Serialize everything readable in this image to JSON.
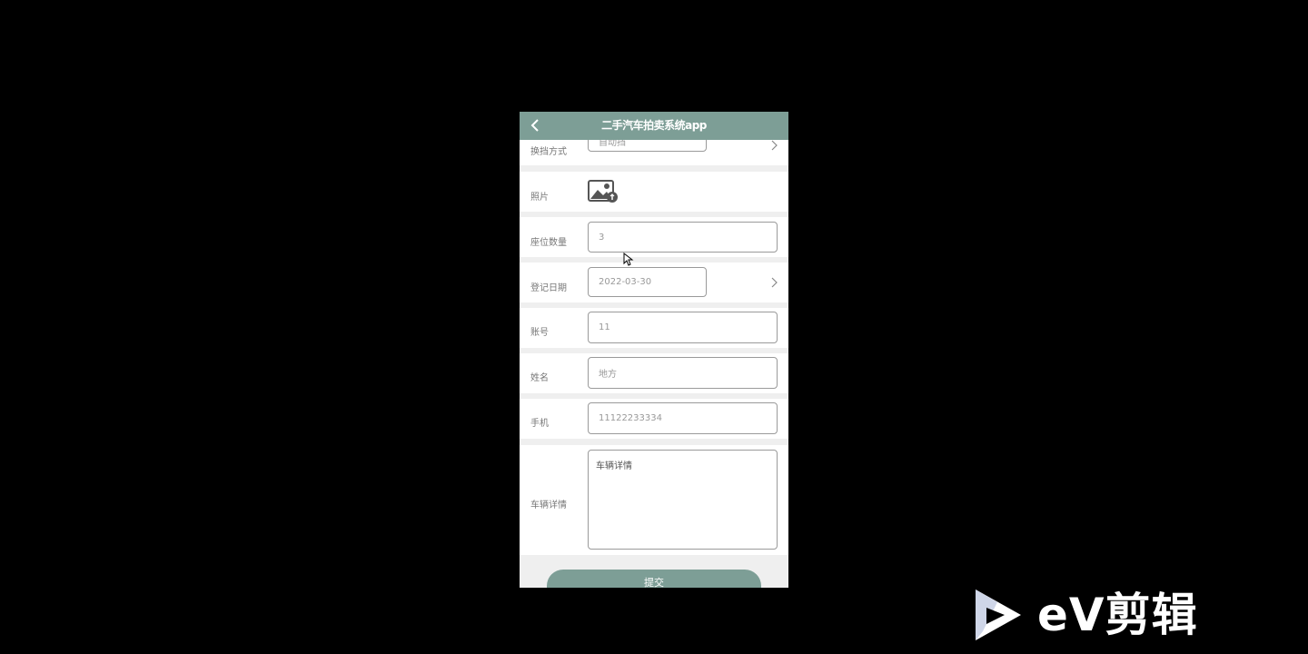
{
  "app": {
    "title": "二手汽车拍卖系统app",
    "accent": "#7d9e96"
  },
  "form": {
    "transmission": {
      "label": "换挡方式",
      "value": "自动挡"
    },
    "photo": {
      "label": "照片"
    },
    "seats": {
      "label": "座位数量",
      "value": "3"
    },
    "reg_date": {
      "label": "登记日期",
      "value": "2022-03-30"
    },
    "account": {
      "label": "账号",
      "value": "11"
    },
    "name": {
      "label": "姓名",
      "value": "地方"
    },
    "phone": {
      "label": "手机",
      "value": "11122233334"
    },
    "details": {
      "label": "车辆详情",
      "value": "车辆详情"
    },
    "submit_label": "提交"
  },
  "watermark": {
    "text": "eV剪辑"
  }
}
